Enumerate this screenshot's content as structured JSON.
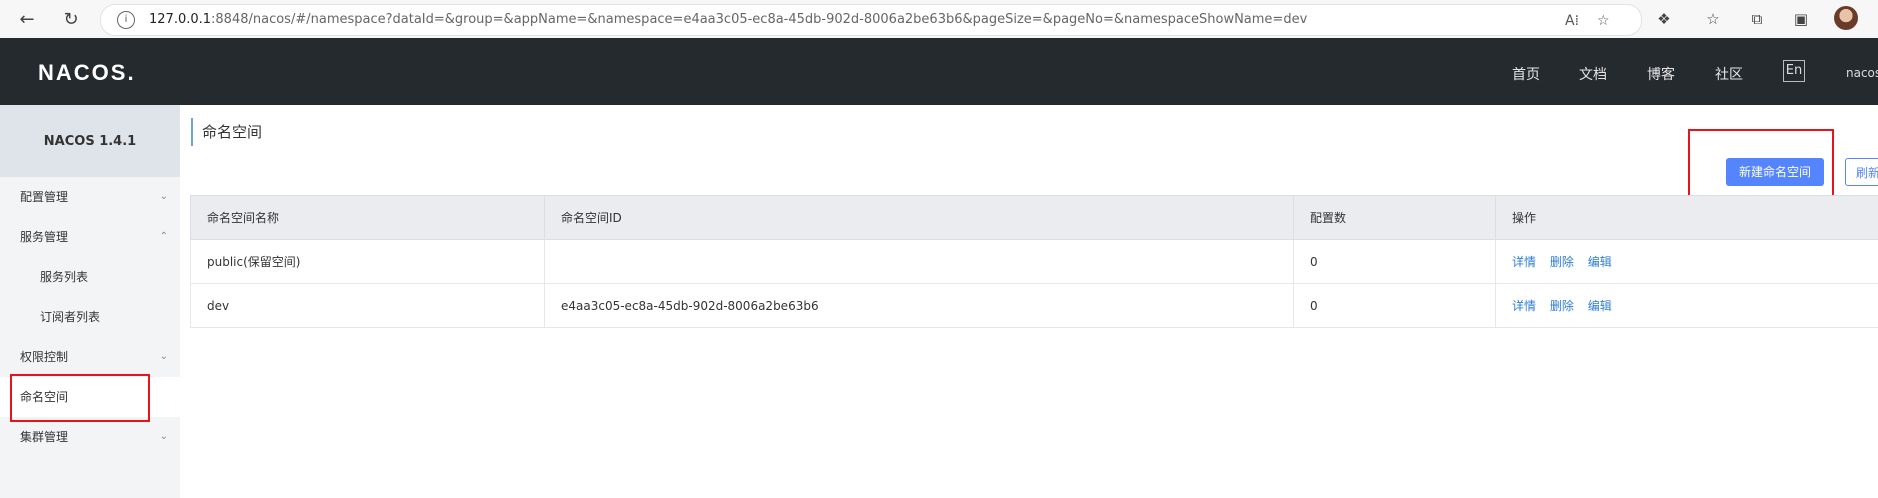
{
  "browser": {
    "url_host": "127.0.0.1",
    "url_rest": ":8848/nacos/#/namespace?dataId=&group=&appName=&namespace=e4aa3c05-ec8a-45db-902d-8006a2be63b6&pageSize=&pageNo=&namespaceShowName=dev"
  },
  "header": {
    "logo": "NACOS.",
    "nav": [
      "首页",
      "文档",
      "博客",
      "社区"
    ],
    "lang": "En",
    "user": "nacos"
  },
  "sidebar": {
    "title": "NACOS 1.4.1",
    "items": [
      {
        "label": "配置管理",
        "chevron": "down"
      },
      {
        "label": "服务管理",
        "chevron": "up"
      },
      {
        "label": "服务列表"
      },
      {
        "label": "订阅者列表"
      },
      {
        "label": "权限控制",
        "chevron": "down"
      },
      {
        "label": "命名空间"
      },
      {
        "label": "集群管理",
        "chevron": "down"
      }
    ]
  },
  "main": {
    "title": "命名空间",
    "new_button": "新建命名空间",
    "refresh_button": "刷新",
    "columns": [
      "命名空间名称",
      "命名空间ID",
      "配置数",
      "操作"
    ],
    "rows": [
      {
        "name": "public(保留空间)",
        "id": "",
        "count": "0",
        "ops": [
          "详情",
          "删除",
          "编辑"
        ]
      },
      {
        "name": "dev",
        "id": "e4aa3c05-ec8a-45db-902d-8006a2be63b6",
        "count": "0",
        "ops": [
          "详情",
          "删除",
          "编辑"
        ]
      }
    ]
  },
  "colors": {
    "header_bg": "#252a2f",
    "primary": "#5584ff",
    "link": "#2f7ed8",
    "highlight_box": "#e8141c"
  }
}
